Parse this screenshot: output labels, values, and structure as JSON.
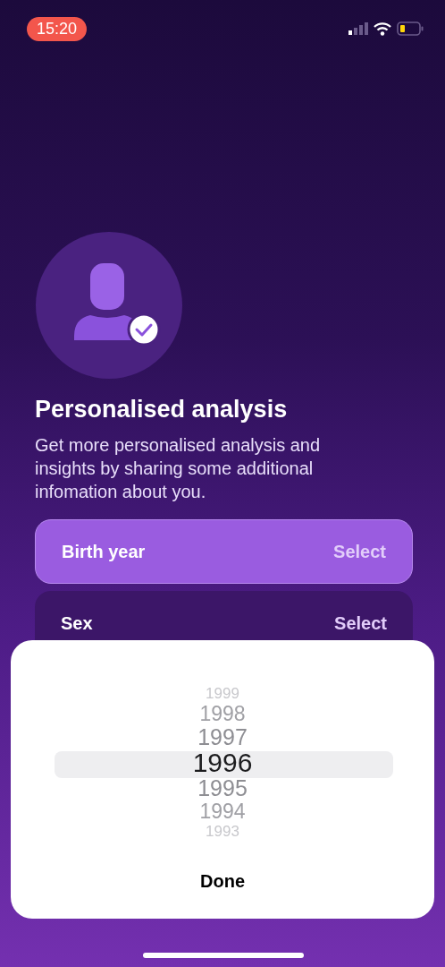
{
  "status_bar": {
    "time": "15:20"
  },
  "title": "Personalised analysis",
  "description": "Get more personalised analysis and insights by sharing some additional infomation about you.",
  "fields": [
    {
      "label": "Birth year",
      "value": "Select",
      "selected": true
    },
    {
      "label": "Sex",
      "value": "Select",
      "selected": false
    }
  ],
  "picker": {
    "years": [
      {
        "label": "1999",
        "selected": false
      },
      {
        "label": "1998",
        "selected": false
      },
      {
        "label": "1997",
        "selected": false
      },
      {
        "label": "1996",
        "selected": true
      },
      {
        "label": "1995",
        "selected": false
      },
      {
        "label": "1994",
        "selected": false
      },
      {
        "label": "1993",
        "selected": false
      }
    ],
    "button": "Done"
  }
}
